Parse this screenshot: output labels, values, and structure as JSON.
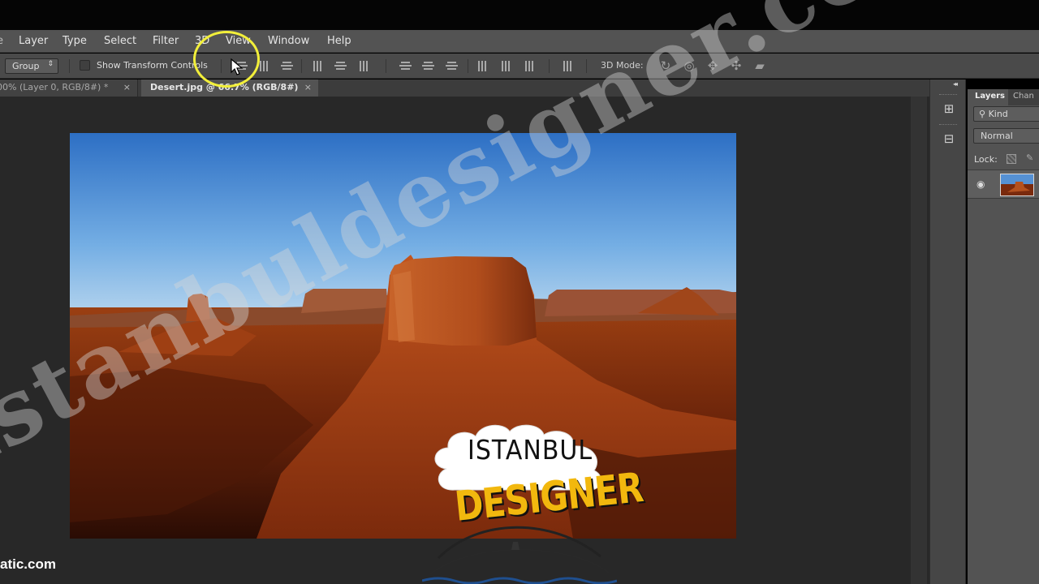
{
  "menu": {
    "items": [
      "Layer",
      "Type",
      "Select",
      "Filter",
      "3D",
      "View",
      "Window",
      "Help"
    ]
  },
  "options": {
    "auto_select_value": "Group",
    "show_transform_label": "Show Transform Controls",
    "mode_label": "3D Mode:"
  },
  "tabs": {
    "inactive_label": "00% (Layer 0, RGB/8#) *",
    "inactive_close": "×",
    "active_label": "Desert.jpg @ 66.7% (RGB/8#)",
    "active_close": "×"
  },
  "panel": {
    "tab_layers": "Layers",
    "tab_channels": "Chan",
    "kind_label": "Kind",
    "blend_mode": "Normal",
    "lock_label": "Lock:"
  },
  "overlay": {
    "watermark": "istanbuldesigner.com",
    "corner_text": "atic.com",
    "logo_word1": "ISTANBUL",
    "logo_word2": "DESIGNER"
  },
  "icons": {
    "highlight_color": "#f2ef3a",
    "sky_color": "#3f8fd9",
    "rock_color": "#b8501c"
  }
}
